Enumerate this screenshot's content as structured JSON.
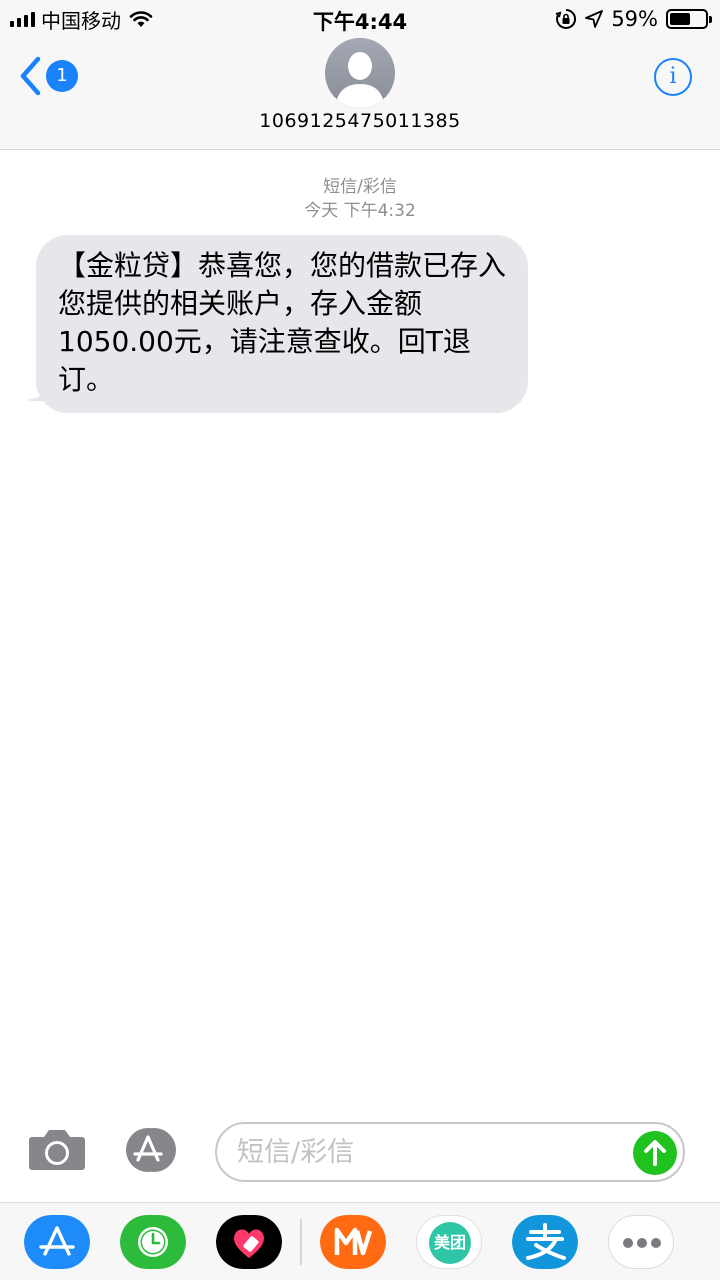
{
  "status_bar": {
    "carrier": "中国移动",
    "time": "下午4:44",
    "battery_percent": "59%",
    "battery_level": 0.59
  },
  "nav": {
    "back_badge": "1",
    "contact_number": "1069125475011385",
    "info_glyph": "i"
  },
  "conversation": {
    "message_type": "短信/彩信",
    "timestamp": "今天 下午4:32",
    "messages": [
      {
        "direction": "incoming",
        "text": "【金粒贷】恭喜您，您的借款已存入您提供的相关账户，存入金额1050.00元，请注意查收。回T退订。"
      }
    ]
  },
  "composer": {
    "placeholder": "短信/彩信",
    "value": ""
  },
  "app_drawer": {
    "apps": [
      {
        "name": "app-store-icon",
        "color": "#1d8cf8"
      },
      {
        "name": "clock-icon",
        "color": "#2dbb3c"
      },
      {
        "name": "heart-sticker-icon",
        "color": "#000000"
      },
      {
        "name": "mango-tv-icon",
        "color": "#ff6a13"
      },
      {
        "name": "meituan-icon",
        "label": "美团",
        "color": "#2fc6a7"
      },
      {
        "name": "alipay-icon",
        "color": "#1296db"
      },
      {
        "name": "more-icon",
        "color": "#ffffff"
      }
    ]
  },
  "colors": {
    "accent": "#1a82fb",
    "send_button": "#1fc21f",
    "bubble_incoming": "#e6e6eb",
    "meta_text": "#8e8e93"
  }
}
